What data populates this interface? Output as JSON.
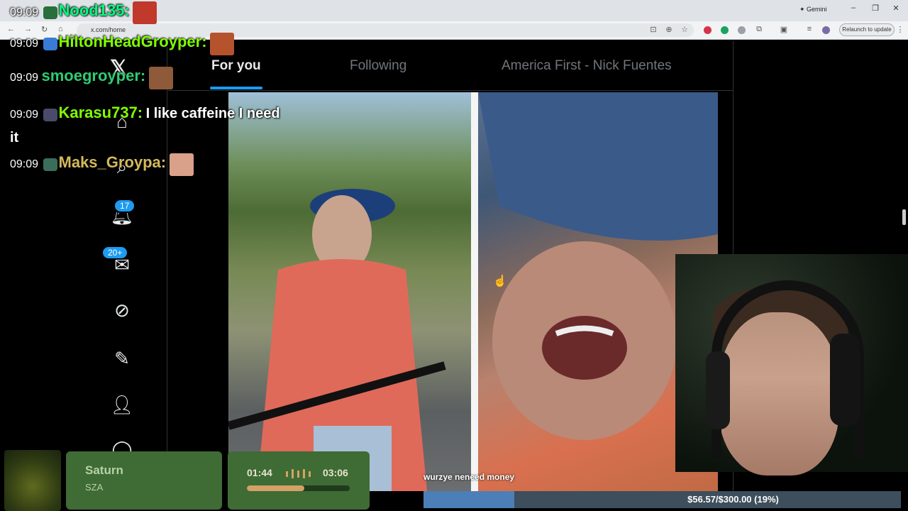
{
  "browser": {
    "gemini_label": "Gemini",
    "url": "x.com/home",
    "relaunch_label": "Relaunch to update"
  },
  "x": {
    "tabs": [
      {
        "label": "For you",
        "active": true
      },
      {
        "label": "Following",
        "active": false
      },
      {
        "label": "America First - Nick Fuentes",
        "active": false
      }
    ],
    "badges": {
      "notifications": "17",
      "messages": "20+"
    }
  },
  "chat": [
    {
      "time": "09:09",
      "user": "Nood135:",
      "user_color": "#00ff7f",
      "message": ""
    },
    {
      "time": "09:09",
      "user": "HiltonHeadGroyper:",
      "user_color": "#7fff00",
      "message": ""
    },
    {
      "time": "09:09",
      "user": "smoegroyper:",
      "user_color": "#2ecc71",
      "message": ""
    },
    {
      "time": "09:09",
      "user": "Karasu737:",
      "user_color": "#7fff00",
      "message": "I like caffeine I need it"
    },
    {
      "time": "09:09",
      "user": "Maks_Groypa:",
      "user_color": "#d4b85c",
      "message": ""
    }
  ],
  "video": {
    "caption": "wurzye neneed money"
  },
  "now_playing": {
    "title": "Saturn",
    "artist": "SZA",
    "elapsed": "01:44",
    "duration": "03:06",
    "progress": 0.56
  },
  "goal": {
    "text": "$56.57/$300.00 (19%)",
    "progress": 0.19
  }
}
